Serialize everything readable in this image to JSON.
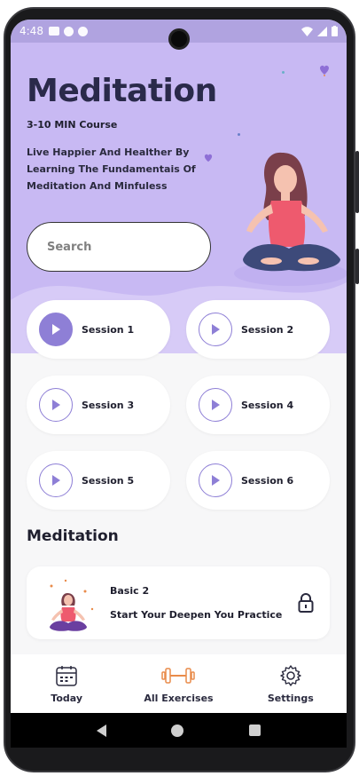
{
  "status_bar": {
    "time": "4:48"
  },
  "hero": {
    "title": "Meditation",
    "subtitle": "3-10 MIN Course",
    "description": "Live Happier And Healther By Learning The Fundamentais Of Meditation And Minfuless",
    "search_placeholder": "Search"
  },
  "sessions": [
    {
      "label": "Session 1",
      "active": true
    },
    {
      "label": "Session 2",
      "active": false
    },
    {
      "label": "Session 3",
      "active": false
    },
    {
      "label": "Session 4",
      "active": false
    },
    {
      "label": "Session 5",
      "active": false
    },
    {
      "label": "Session 6",
      "active": false
    }
  ],
  "section": {
    "title": "Meditation"
  },
  "course_card": {
    "title": "Basic 2",
    "subtitle": "Start Your Deepen You Practice",
    "locked": true
  },
  "bottom_nav": [
    {
      "label": "Today",
      "icon": "calendar-icon"
    },
    {
      "label": "All Exercises",
      "icon": "dumbbell-icon",
      "active": true
    },
    {
      "label": "Settings",
      "icon": "gear-icon"
    }
  ],
  "colors": {
    "accent": "#8e7fd6",
    "hero_bg": "#c8b9f3",
    "active_nav": "#e98b4a",
    "text_dark": "#1f1f2e"
  }
}
